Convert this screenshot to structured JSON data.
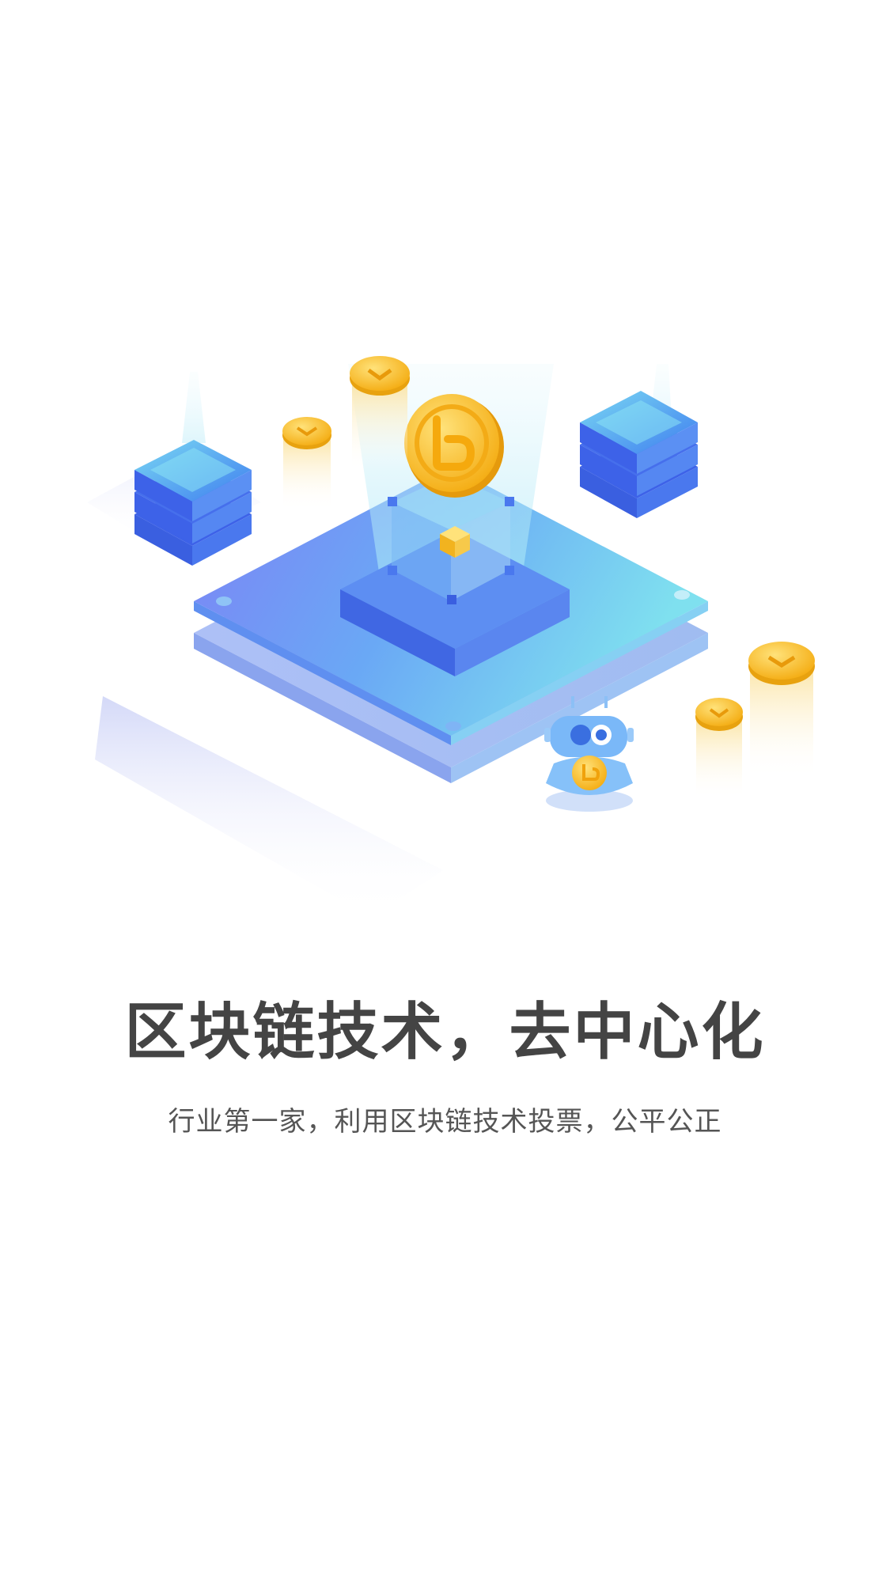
{
  "onboarding": {
    "headline": "区块链技术，去中心化",
    "subline": "行业第一家，利用区块链技术投票，公平公正"
  },
  "colors": {
    "accent_blue": "#4a7cf0",
    "accent_cyan": "#6fd8f2",
    "coin_gold": "#f6b81e",
    "headline_text": "#444444",
    "subline_text": "#555555"
  },
  "illustration": {
    "icons": [
      "blockchain-platform-icon",
      "server-stack-icon",
      "coin-icon",
      "robot-mascot-icon",
      "cube-icon"
    ]
  }
}
